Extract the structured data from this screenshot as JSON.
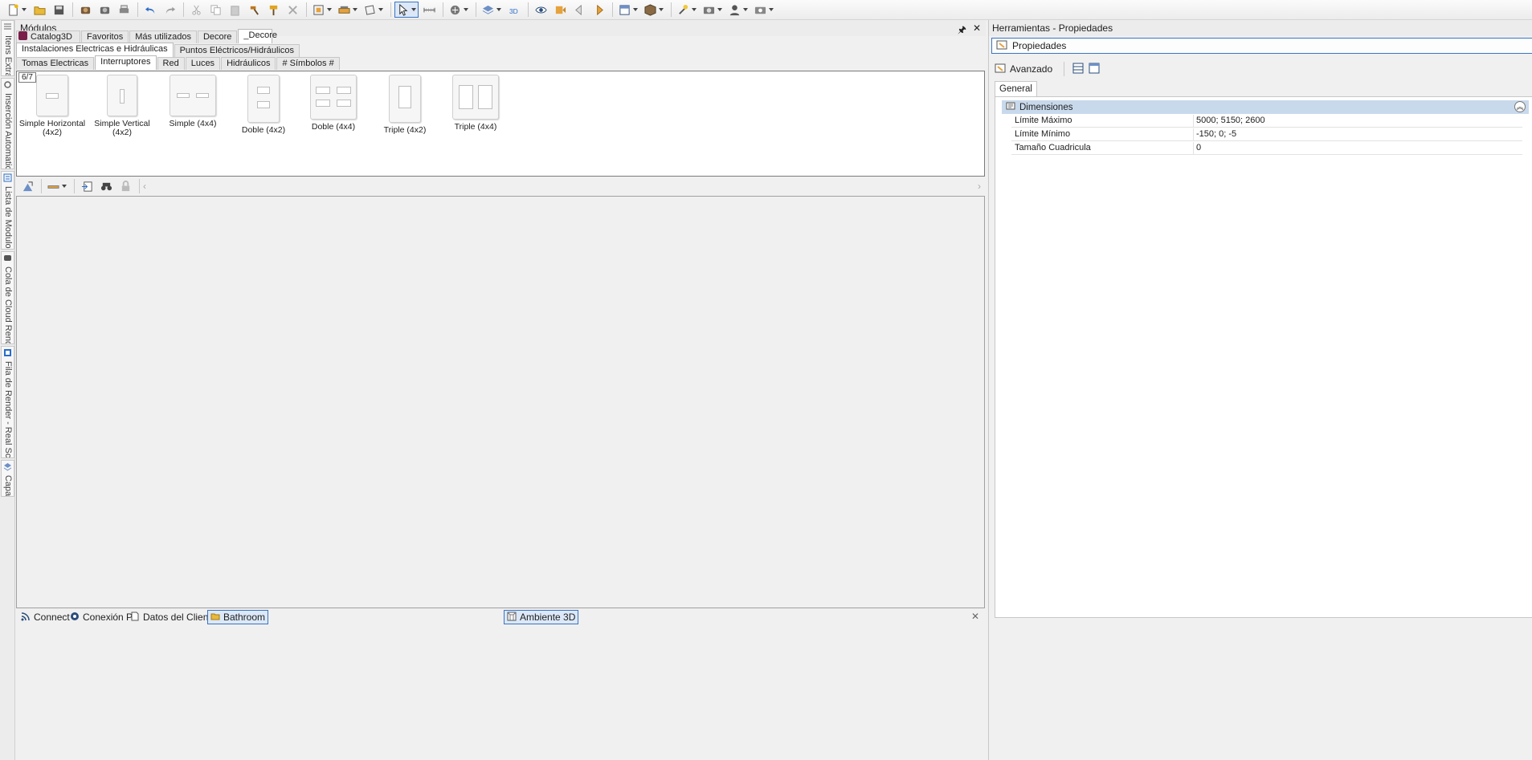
{
  "toolbar": {
    "icons": [
      "new-file-icon",
      "open-folder-icon",
      "save-icon",
      "render-icon",
      "render-settings-icon",
      "print-icon",
      "undo-icon",
      "redo-icon",
      "cut-icon",
      "copy-icon",
      "paste-icon",
      "hammer-icon",
      "brush-icon",
      "delete-icon",
      "wall-icon",
      "furniture-icon",
      "shape-icon",
      "pointer-icon",
      "measure-icon",
      "spline-icon",
      "layers-icon",
      "3d-icon",
      "eye-icon",
      "camera-left-icon",
      "camera-prev-icon",
      "camera-next-icon",
      "view-icon",
      "box-icon",
      "light-icon",
      "camera-icon",
      "user-icon",
      "photo-icon"
    ]
  },
  "sidebar": {
    "tabs": [
      {
        "label": "Itens Extras"
      },
      {
        "label": "Inserción Automatica"
      },
      {
        "label": "Lista de Modulos"
      },
      {
        "label": "Cola de Cloud Render"
      },
      {
        "label": "Fila de Render - Real Scene"
      },
      {
        "label": "Capas"
      }
    ]
  },
  "modules": {
    "title": "Módulos",
    "pin": "🖈",
    "close": "✕",
    "tabs_row1": [
      "Catalog3D",
      "Favoritos",
      "Más utilizados",
      "Decore",
      "_Decore"
    ],
    "tabs_row2": [
      "Instalaciones Electricas e Hidráulicas",
      "Puntos Eléctricos/Hidráulicos"
    ],
    "tabs_row3": [
      "Tomas Electricas",
      "Interruptores",
      "Red",
      "Luces",
      "Hidráulicos",
      "# Símbolos #"
    ],
    "page_indicator": "6/7",
    "items": [
      {
        "label": "Simple Horizontal (4x2)"
      },
      {
        "label": "Simple Vertical (4x2)"
      },
      {
        "label": "Simple (4x4)"
      },
      {
        "label": "Doble (4x2)"
      },
      {
        "label": "Doble (4x4)"
      },
      {
        "label": "Triple (4x2)"
      },
      {
        "label": "Triple (4x4)"
      }
    ]
  },
  "bottom_tabs": [
    {
      "label": "Connect"
    },
    {
      "label": "Conexión P"
    },
    {
      "label": "Datos del Cliente"
    },
    {
      "label": "Bathroom"
    },
    {
      "label": "Ambiente 3D"
    }
  ],
  "properties": {
    "title": "Herramientas - Propiedades",
    "header": "Propiedades",
    "advanced": "Avanzado",
    "tab": "General",
    "category": "Dimensiones",
    "rows": [
      {
        "name": "Límite Máximo",
        "value": "5000; 5150; 2600"
      },
      {
        "name": "Límite Mínimo",
        "value": "-150; 0; -5"
      },
      {
        "name": "Tamaño Cuadricula",
        "value": "0"
      }
    ]
  },
  "colors": {
    "accent": "#3a75c4",
    "category_bg": "#c9d9ec"
  }
}
